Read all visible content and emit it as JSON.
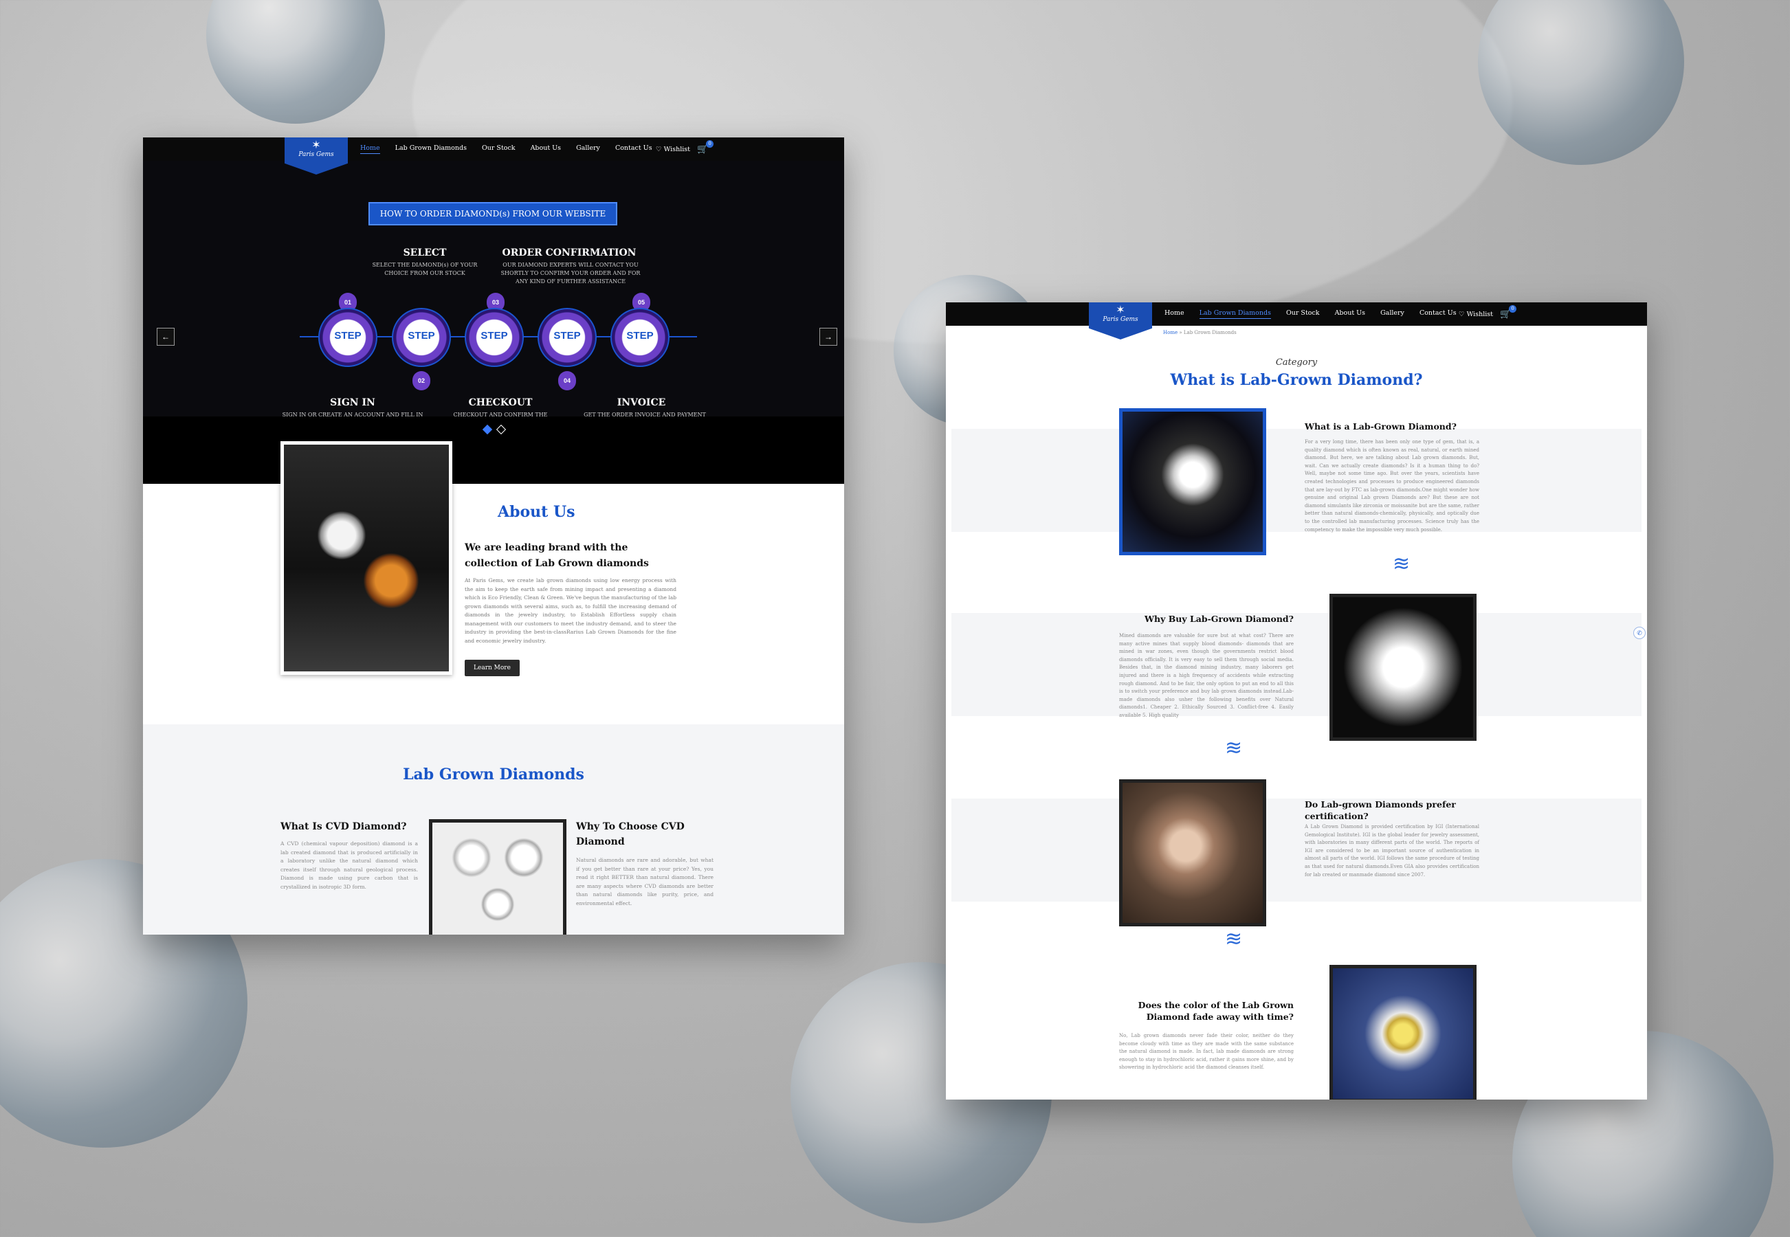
{
  "brand": {
    "logo_text": "Paris Gems"
  },
  "left": {
    "nav": {
      "items": [
        "Home",
        "Lab Grown Diamonds",
        "Our Stock",
        "About Us",
        "Gallery",
        "Contact Us"
      ],
      "active": "Home",
      "wishlist": "Wishlist",
      "cart_count": "0"
    },
    "hero": {
      "button": "HOW TO ORDER DIAMOND(s) FROM OUR WEBSITE",
      "step_label": "STEP",
      "steps": [
        {
          "num": "01",
          "title": "SELECT",
          "desc": "SELECT THE DIAMOND(s) OF YOUR CHOICE FROM OUR STOCK"
        },
        {
          "num": "02",
          "title": "SIGN IN",
          "desc": "SIGN IN OR CREATE AN ACCOUNT AND FILL IN ALL THE NECESSARY DETAILS"
        },
        {
          "num": "03",
          "title": "ORDER CONFIRMATION",
          "desc": "OUR DIAMOND EXPERTS WILL CONTACT YOU SHORTLY TO CONFIRM YOUR ORDER AND FOR ANY KIND OF FURTHER ASSISTANCE"
        },
        {
          "num": "04",
          "title": "CHECKOUT",
          "desc": "CHECKOUT AND CONFIRM THE ORDER"
        },
        {
          "num": "05",
          "title": "INVOICE",
          "desc": "GET THE ORDER INVOICE AND PAYMENT DETAILS AFTER CONFIRMING YOUR ORDER"
        }
      ],
      "prev": "←",
      "next": "→"
    },
    "about": {
      "title": "About Us",
      "subtitle": "We are leading brand with the collection of Lab Grown diamonds",
      "body": "At Paris Gems, we create lab grown diamonds using low energy process with the aim to keep the earth safe from mining impact and presenting a diamond which is Eco Friendly, Clean & Green. We've begun the manufacturing of the lab grown diamonds with several aims, such as, to fulfill the increasing demand of diamonds in the jewelry industry, to Establish Effortless supply chain management with our customers to meet the industry demand, and to steer the industry in providing the best-in-classRarius Lab Grown Diamonds for the fine and economic jewelry industry.",
      "button": "Learn More"
    },
    "lab": {
      "title": "Lab Grown Diamonds",
      "cvd_title": "What Is CVD Diamond?",
      "cvd_body": "A CVD (chemical vapour deposition) diamond is a lab created diamond that is produced artificially in a laboratory unlike the natural diamond which creates itself through natural geological process. Diamond is made using pure carbon that is crystallized in isotropic 3D form.",
      "why_title": "Why To Choose CVD Diamond",
      "why_body": "Natural diamonds are rare and adorable, but what if you get better than rare at your price? Yes, you read it right BETTER than natural diamond. There are many aspects where CVD diamonds are better than natural diamonds like purity, price, and environmental effect."
    }
  },
  "right": {
    "nav": {
      "items": [
        "Home",
        "Lab Grown Diamonds",
        "Our Stock",
        "About Us",
        "Gallery",
        "Contact Us"
      ],
      "active": "Lab Grown Diamonds",
      "wishlist": "Wishlist",
      "cart_count": "0"
    },
    "breadcrumb": {
      "home": "Home",
      "sep": "»",
      "current": "Lab Grown Diamonds"
    },
    "category_label": "Category",
    "title": "What is Lab-Grown Diamond?",
    "sections": [
      {
        "title": "What is a Lab-Grown Diamond?",
        "body": "For a very long time, there has been only one type of gem, that is, a quality diamond which is often known as real, natural, or earth mined diamond. But here, we are talking about Lab grown diamonds. But, wait. Can we actually create diamonds? Is it a human thing to do? Well, maybe not some time ago. But over the years, scientists have created technologies and processes to produce engineered diamonds that are lay-out by FTC as lab-grown diamonds.One might wonder how genuine and original Lab grown Diamonds are? But these are not diamond simulants like zirconia or moissanite but are the same, rather better than natural diamonds-chemically, physically, and optically due to the controlled lab manufacturing processes. Science truly has the competency to make the impossible very much possible."
      },
      {
        "title": "Why Buy Lab-Grown Diamond?",
        "body": "Mined diamonds are valuable for sure but at what cost? There are many active mines that supply blood diamonds- diamonds that are mined in war zones, even though the governments restrict blood diamonds officially. It is very easy to sell them through social media. Besides that, in the diamond mining industry, many laborers get injured and there is a high frequency of accidents while extracting rough diamond. And to be fair, the only option to put an end to all this is to switch your preference and buy lab grown diamonds instead.Lab-made diamonds also usher the following benefits over Natural diamonds1. Cheaper 2. Ethically Sourced 3. Conflict-free 4. Easily available 5. High quality"
      },
      {
        "title": "Do Lab-grown Diamonds prefer certification?",
        "body": "A Lab Grown Diamond is provided certification by IGI (International Gemological Institute). IGI is the global leader for jewelry assessment, with laboratories in many different parts of the world. The reports of IGI are considered to be an important source of authentication in almost all parts of the world. IGI follows the same procedure of testing as that used for natural diamonds.Even GIA also provides certification for lab created or manmade diamond since 2007."
      },
      {
        "title": "Does the color of the Lab Grown Diamond fade away with time?",
        "body": "No, Lab grown diamonds never fade their color, neither do they become cloudy with time as they are made with the same substance the natural diamond is made. In fact, lab made diamonds are strong enough to stay in hydrochloric acid, rather it gains more shine, and by showering in hydrochloric acid the diamond cleanses itself."
      }
    ]
  }
}
